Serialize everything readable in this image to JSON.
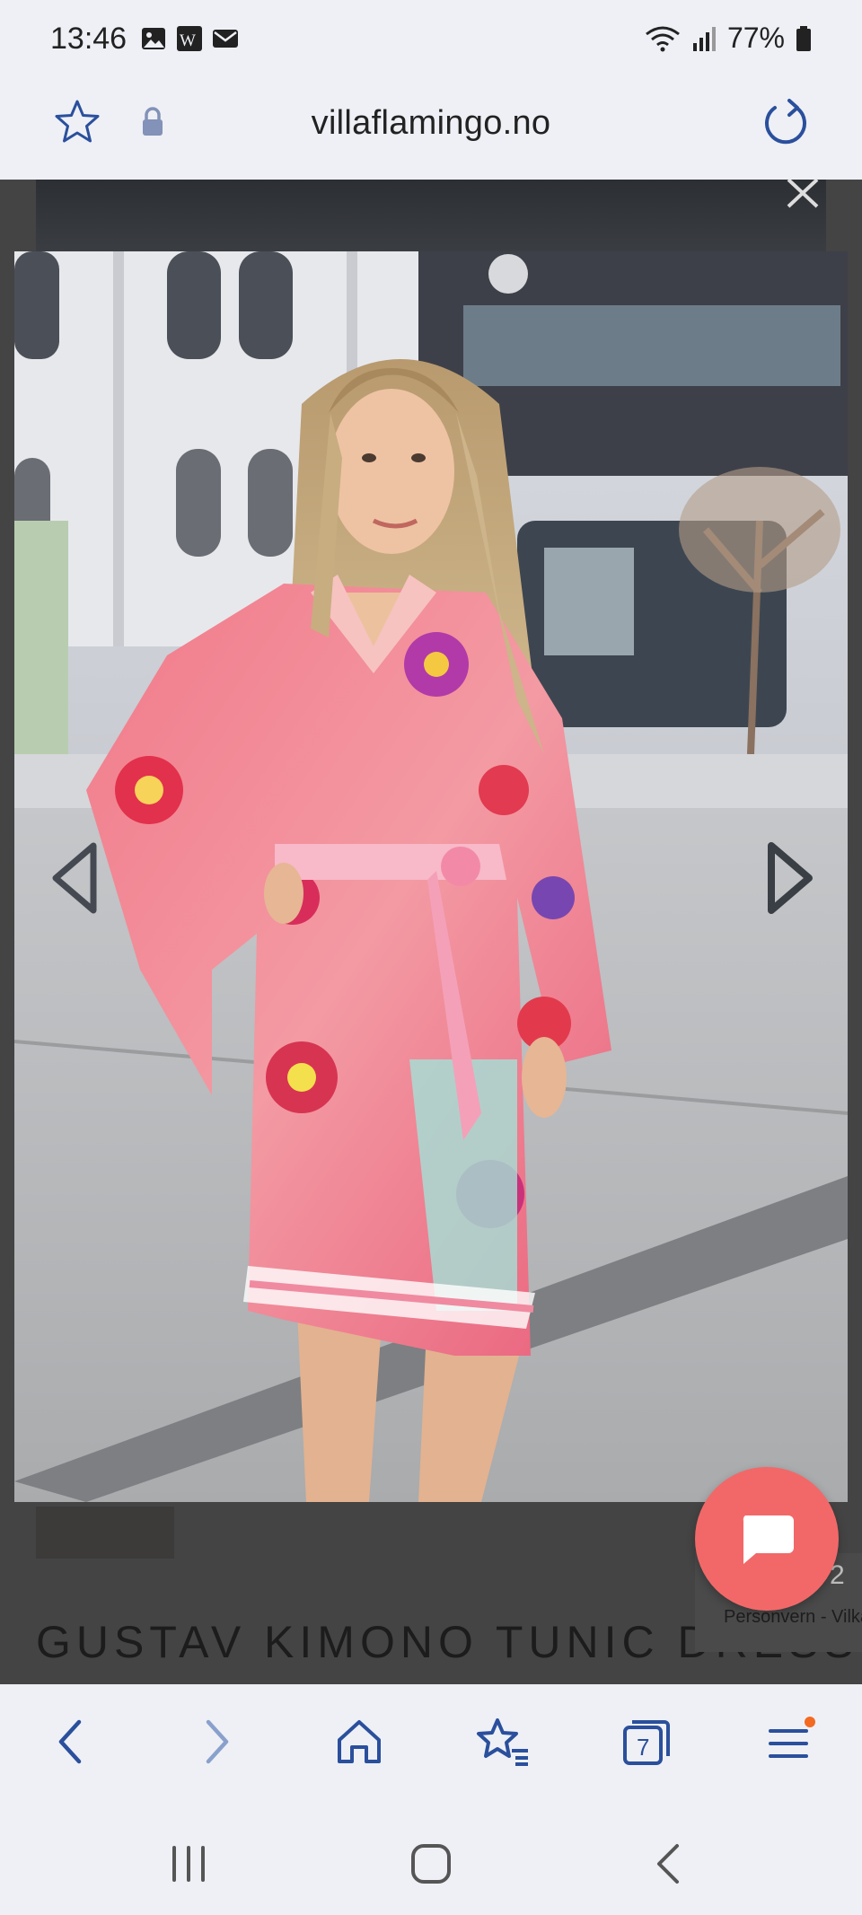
{
  "status_bar": {
    "time": "13:46",
    "battery": "77%",
    "icons": [
      "gallery-icon",
      "wordpress-icon",
      "mail-icon",
      "wifi-icon",
      "signal-icon",
      "battery-icon"
    ]
  },
  "browser": {
    "url": "villaflamingo.no",
    "icons": [
      "star-icon",
      "lock-icon",
      "reload-icon"
    ]
  },
  "page": {
    "product_title": "GUSTAV KIMONO TUNIC DRESS",
    "privacy_label": "Personvern - Vilkår",
    "privacy_count": "2"
  },
  "lightbox": {
    "image_alt": "Woman wearing a pink floral kimono tunic dress",
    "prev_icon": "chevron-left-icon",
    "next_icon": "chevron-right-icon",
    "close_icon": "close-icon"
  },
  "chat": {
    "icon": "chat-bubble-icon"
  },
  "bottom_nav": {
    "tabs_count": "7",
    "icons": [
      "back-icon",
      "forward-icon",
      "home-icon",
      "bookmarks-icon",
      "tabs-icon",
      "menu-icon"
    ]
  },
  "colors": {
    "accent_blue": "#2a4f9c",
    "fab": "#f26868",
    "notification_dot": "#f36a21"
  }
}
